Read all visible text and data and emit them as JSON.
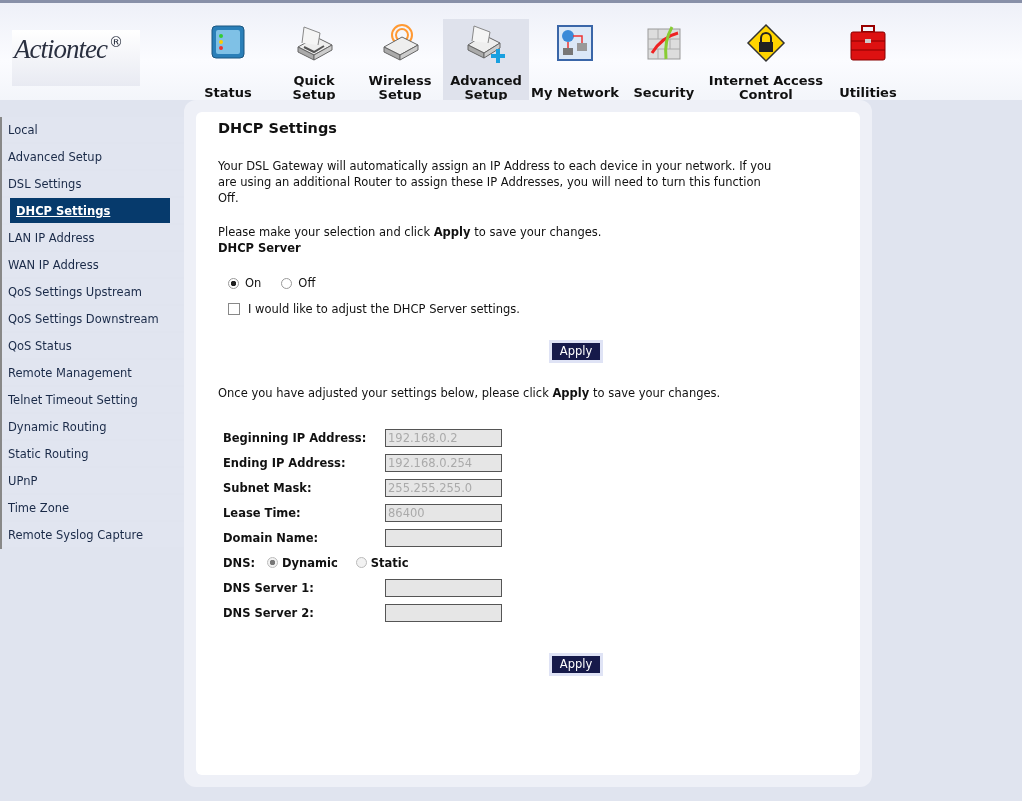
{
  "logo": {
    "text": "Actiontec",
    "mark": "®"
  },
  "nav": [
    {
      "lines": [
        "Status"
      ],
      "selected": false
    },
    {
      "lines": [
        "Quick",
        "Setup"
      ],
      "selected": false
    },
    {
      "lines": [
        "Wireless",
        "Setup"
      ],
      "selected": false
    },
    {
      "lines": [
        "Advanced",
        "Setup"
      ],
      "selected": true
    },
    {
      "lines": [
        "My Network"
      ],
      "selected": false
    },
    {
      "lines": [
        "Security"
      ],
      "selected": false
    },
    {
      "lines": [
        "Internet Access",
        "Control"
      ],
      "selected": false
    },
    {
      "lines": [
        "Utilities"
      ],
      "selected": false
    }
  ],
  "sidebar": {
    "items": [
      {
        "label": "Local",
        "selected": false
      },
      {
        "label": "Advanced Setup",
        "selected": false
      },
      {
        "label": "DSL Settings",
        "selected": false
      },
      {
        "label": "DHCP Settings",
        "selected": true
      },
      {
        "label": "LAN IP Address",
        "selected": false
      },
      {
        "label": "WAN IP Address",
        "selected": false
      },
      {
        "label": "QoS Settings Upstream",
        "selected": false
      },
      {
        "label": "QoS Settings Downstream",
        "selected": false
      },
      {
        "label": "QoS Status",
        "selected": false
      },
      {
        "label": "Remote Management",
        "selected": false
      },
      {
        "label": "Telnet Timeout Setting",
        "selected": false
      },
      {
        "label": "Dynamic Routing",
        "selected": false
      },
      {
        "label": "Static Routing",
        "selected": false
      },
      {
        "label": "UPnP",
        "selected": false
      },
      {
        "label": "Time Zone",
        "selected": false
      },
      {
        "label": "Remote Syslog Capture",
        "selected": false
      }
    ]
  },
  "content": {
    "title": "DHCP Settings",
    "intro": "Your DSL Gateway will automatically assign an IP Address to each device in your network. If you are using an additional Router to assign these IP Addresses, you will need to turn this function Off.",
    "instruction": "Please make your selection and click **Apply** to save your changes.",
    "server_label": "DHCP Server",
    "server_options": [
      {
        "label": "On",
        "selected": true
      },
      {
        "label": "Off",
        "selected": false
      }
    ],
    "adjust_checkbox": {
      "label": "I would like to adjust the DHCP Server settings.",
      "checked": false
    },
    "apply_top": "Apply",
    "note": "Once you have adjusted your settings below, please click **Apply** to save your changes.",
    "form_rows": [
      {
        "kind": "field",
        "label": "Beginning IP Address:",
        "value": "192.168.0.2",
        "disabled": true
      },
      {
        "kind": "field",
        "label": "Ending IP Address:",
        "value": "192.168.0.254",
        "disabled": true
      },
      {
        "kind": "field",
        "label": "Subnet Mask:",
        "value": "255.255.255.0",
        "disabled": true
      },
      {
        "kind": "field",
        "label": "Lease Time:",
        "value": "86400",
        "disabled": true
      },
      {
        "kind": "field",
        "label": "Domain Name:",
        "disabled": true
      },
      {
        "kind": "radio",
        "label": "DNS:",
        "disabled": true,
        "options": [
          {
            "label": "Dynamic",
            "selected": true
          },
          {
            "label": "Static",
            "selected": false
          }
        ]
      },
      {
        "kind": "field",
        "label": "DNS Server 1:",
        "disabled": true
      },
      {
        "kind": "field",
        "label": "DNS Server 2:",
        "disabled": true
      }
    ],
    "apply_bottom": "Apply"
  }
}
